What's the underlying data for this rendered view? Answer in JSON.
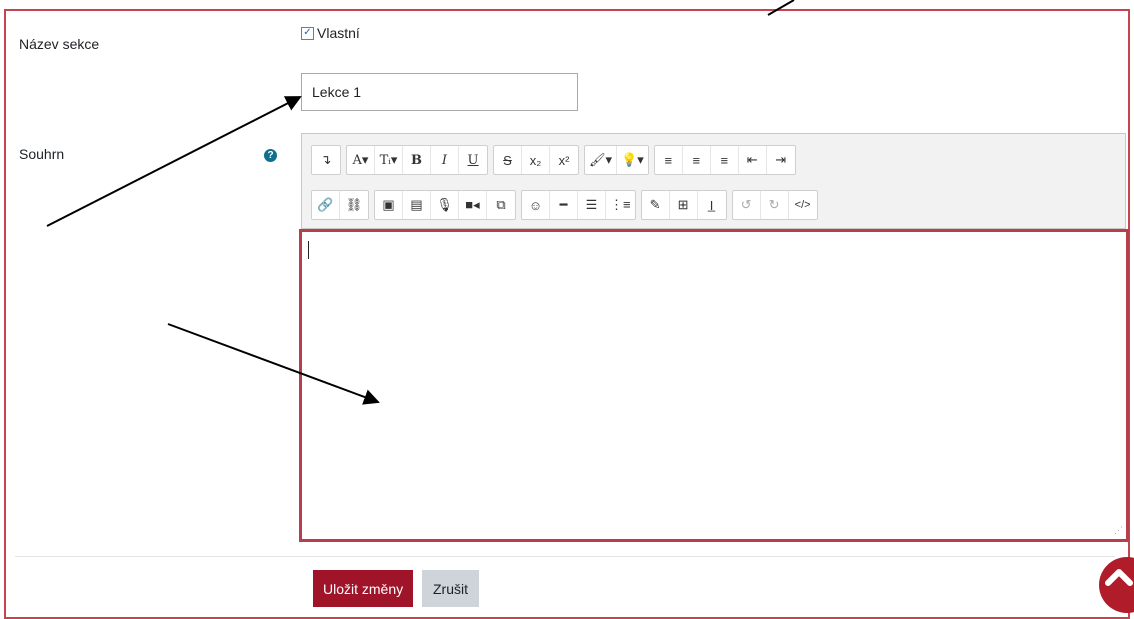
{
  "form": {
    "section_name_label": "Název sekce",
    "custom_label": "Vlastní",
    "custom_checked": true,
    "section_name_value": "Lekce 1",
    "summary_label": "Souhrn",
    "help_icon": "question-circle-icon"
  },
  "toolbar": {
    "row1": [
      [
        "collapse-toggle-icon"
      ],
      [
        "text-color-icon",
        "font-size-icon",
        "bold-icon",
        "italic-icon",
        "underline-icon"
      ],
      [
        "strikethrough-icon",
        "subscript-icon",
        "superscript-icon"
      ],
      [
        "brush-style-icon",
        "lightbulb-icon"
      ],
      [
        "align-left-icon",
        "align-center-icon",
        "align-right-icon",
        "outdent-icon",
        "indent-icon"
      ]
    ],
    "row2": [
      [
        "link-icon",
        "unlink-icon"
      ],
      [
        "image-icon",
        "media-icon",
        "record-audio-icon",
        "record-video-icon",
        "manage-files-icon"
      ],
      [
        "emoji-icon",
        "horizontal-rule-icon",
        "bullet-list-icon",
        "numbered-list-icon"
      ],
      [
        "equation-icon",
        "table-icon",
        "clear-formatting-icon"
      ],
      [
        "undo-icon",
        "redo-icon",
        "html-source-icon"
      ]
    ]
  },
  "editor": {
    "content": ""
  },
  "actions": {
    "save_label": "Uložit změny",
    "cancel_label": "Zrušit"
  },
  "colors": {
    "accent": "#a0142a",
    "frame": "#c4444f",
    "help": "#0f6f8d"
  }
}
